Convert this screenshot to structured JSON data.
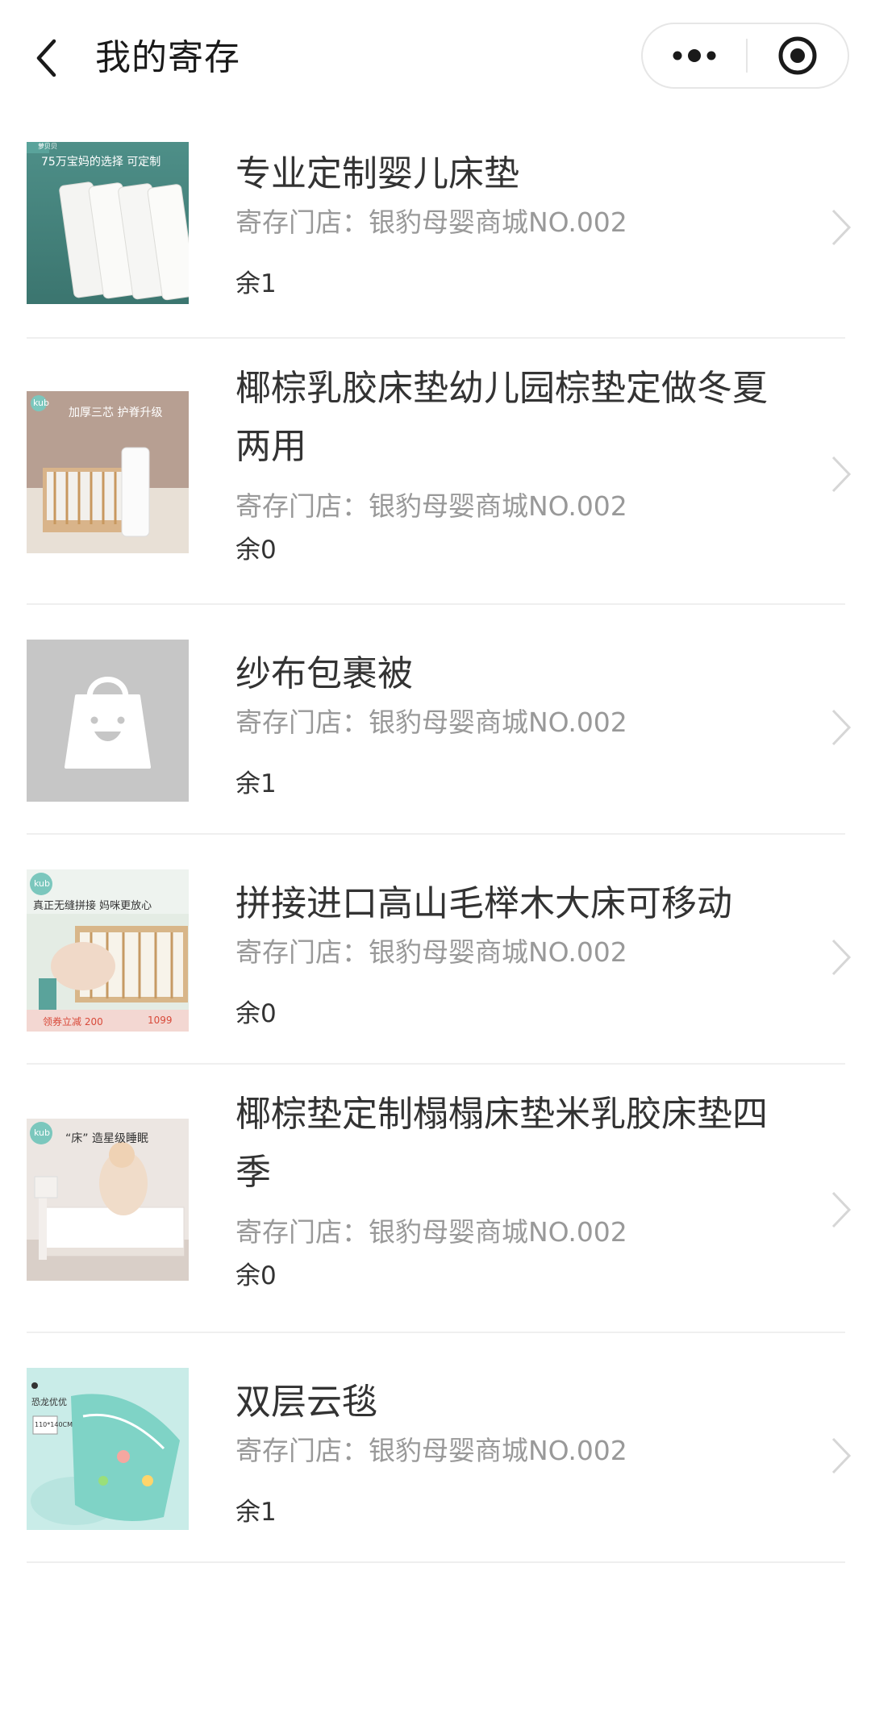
{
  "header": {
    "title": "我的寄存",
    "back_icon": "chevron-left-icon",
    "more_icon": "more-dots-icon",
    "target_icon": "target-icon"
  },
  "items": [
    {
      "title": "专业定制婴儿床垫",
      "store": "寄存门店：银豹母婴商城NO.002",
      "remaining": "余1",
      "thumb_caption": "75万宝妈的选择 可定制",
      "thumb_brand": "萝贝贝"
    },
    {
      "title": "椰棕乳胶床垫幼儿园棕垫定做冬夏两用",
      "store": "寄存门店：银豹母婴商城NO.002",
      "remaining": "余0",
      "thumb_caption": "加厚三芯 护脊升级",
      "thumb_brand": "kub"
    },
    {
      "title": "纱布包裹被",
      "store": "寄存门店：银豹母婴商城NO.002",
      "remaining": "余1",
      "thumb_caption": ""
    },
    {
      "title": "拼接进口高山毛榉木大床可移动",
      "store": "寄存门店：银豹母婴商城NO.002",
      "remaining": "余0",
      "thumb_caption": "真正无缝拼接 妈咪更放心",
      "thumb_brand": "kub",
      "thumb_promo": "领券立减 200",
      "thumb_price": "1099"
    },
    {
      "title": "椰棕垫定制榻榻床垫米乳胶床垫四季",
      "store": "寄存门店：银豹母婴商城NO.002",
      "remaining": "余0",
      "thumb_caption": "“床” 造星级睡眠",
      "thumb_brand": "kub"
    },
    {
      "title": "双层云毯",
      "store": "寄存门店：银豹母婴商城NO.002",
      "remaining": "余1",
      "thumb_caption": "恐龙优优",
      "thumb_size": "110*140CM"
    }
  ],
  "colors": {
    "title_text": "#333333",
    "store_text": "#999999",
    "separator": "#efefef",
    "chevron": "#d6d6d6",
    "placeholder_bg": "#c6c6c6"
  }
}
